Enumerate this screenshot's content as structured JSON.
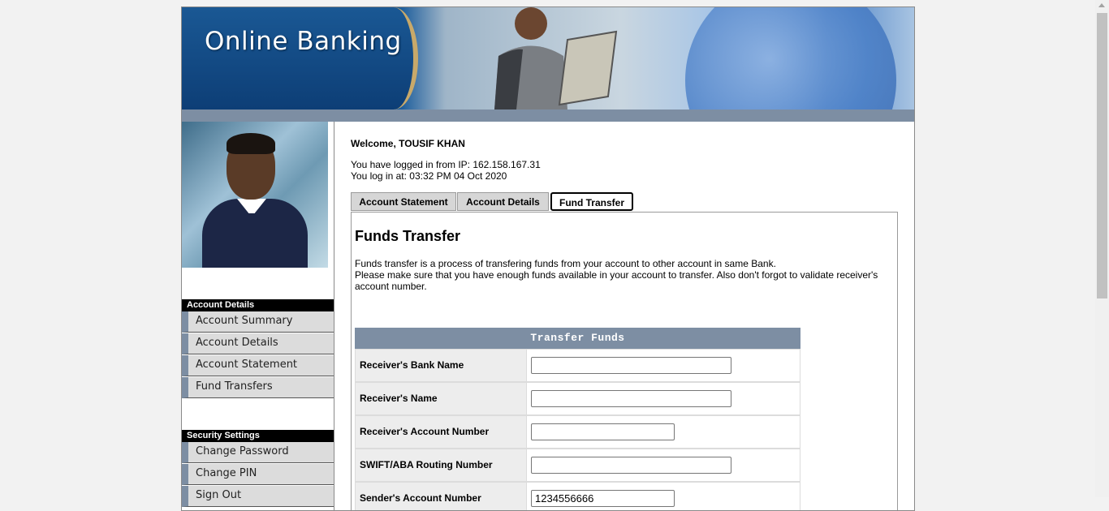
{
  "banner": {
    "title": "Online Banking"
  },
  "sidebar": {
    "account_section": "Account Details",
    "account_items": [
      "Account Summary",
      "Account Details",
      "Account Statement",
      "Fund Transfers"
    ],
    "security_section": "Security Settings",
    "security_items": [
      "Change Password",
      "Change PIN",
      "Sign Out"
    ]
  },
  "main": {
    "welcome": "Welcome, TOUSIF KHAN",
    "ip_line": "You have logged in from IP: 162.158.167.31",
    "login_line": "You log in at: 03:32 PM 04 Oct 2020",
    "tabs": [
      {
        "label": "Account Statement",
        "active": false
      },
      {
        "label": "Account Details",
        "active": false
      },
      {
        "label": "Fund Transfer",
        "active": true
      }
    ],
    "heading": "Funds Transfer",
    "desc_line1": "Funds transfer is a process of transfering funds from your account to other account in same Bank.",
    "desc_line2": "Please make sure that you have enough funds available in your account to transfer. Also don't forgot to validate receiver's account number.",
    "form_title": "Transfer Funds",
    "fields": [
      {
        "label": "Receiver's Bank Name",
        "value": ""
      },
      {
        "label": "Receiver's Name",
        "value": ""
      },
      {
        "label": "Receiver's Account Number",
        "value": ""
      },
      {
        "label": "SWIFT/ABA Routing Number",
        "value": ""
      },
      {
        "label": "Sender's Account Number",
        "value": "1234556666"
      }
    ]
  }
}
